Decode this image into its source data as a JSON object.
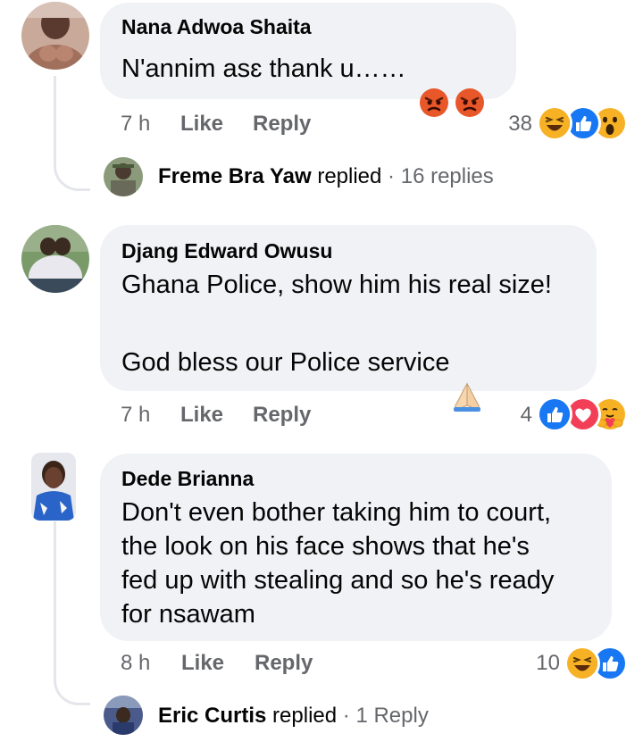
{
  "comments": [
    {
      "author": "Nana Adwoa Shaita",
      "text": "N'annim asɛ thank u……",
      "time": "7 h",
      "like": "Like",
      "reply": "Reply",
      "reaction_count": "38",
      "reactions": [
        "haha-icon",
        "like-icon",
        "wow-icon"
      ],
      "reply_author": "Freme Bra Yaw",
      "reply_text": "replied",
      "reply_count": "16 replies"
    },
    {
      "author": "Djang Edward Owusu",
      "text_line1": "Ghana Police, show him his real size!",
      "text_line2": "God bless our Police service",
      "time": "7 h",
      "like": "Like",
      "reply": "Reply",
      "reaction_count": "4",
      "reactions": [
        "like-icon",
        "love-icon",
        "care-icon"
      ]
    },
    {
      "author": "Dede Brianna",
      "text": "Don't even bother taking him to court,\nthe look on his face shows that he's\nfed up with stealing and so he's ready\nfor nsawam",
      "time": "8 h",
      "like": "Like",
      "reply": "Reply",
      "reaction_count": "10",
      "reactions": [
        "haha-icon",
        "like-icon"
      ],
      "reply_author": "Eric Curtis",
      "reply_text": "replied",
      "reply_count": "1 Reply"
    }
  ],
  "separator": "·",
  "colors": {
    "bubble": "#f0f2f5",
    "muted": "#65676b",
    "like_blue": "#1877f2",
    "love_red": "#f33e58",
    "emoji_yellow": "#f7b125"
  }
}
